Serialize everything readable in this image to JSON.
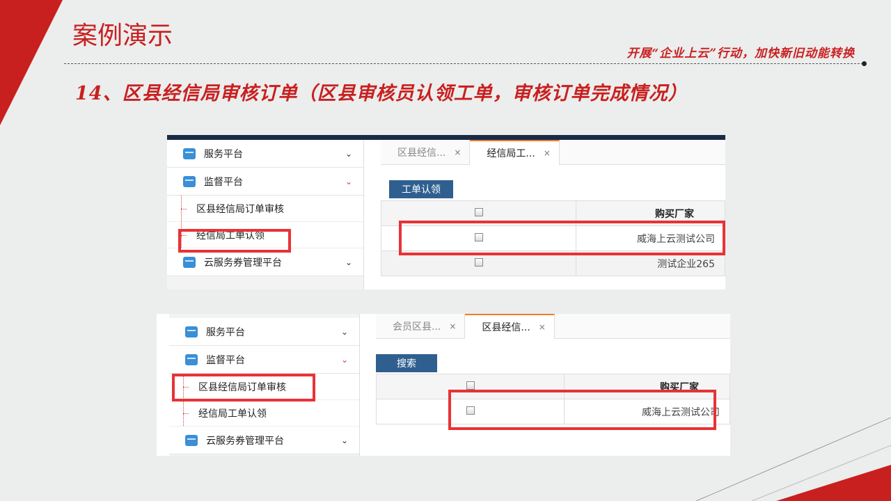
{
  "slide": {
    "title": "案例演示",
    "slogan": "开展“企业上云”行动，加快新旧动能转换",
    "heading": "14、区县经信局审核订单（区县审核员认领工单，审核订单完成情况）",
    "accent_color": "#c8201f"
  },
  "shot1": {
    "sidebar": {
      "items": [
        {
          "label": "服务平台",
          "icon": "folder-icon",
          "chevron": "chevron-down-icon"
        },
        {
          "label": "监督平台",
          "icon": "folder-icon",
          "chevron": "chevron-down-icon"
        }
      ],
      "sub_items": [
        {
          "label": "区县经信局订单审核"
        },
        {
          "label": "经信局工单认领"
        }
      ],
      "last_item": {
        "label": "云服务券管理平台",
        "icon": "folder-icon",
        "chevron": "chevron-down-icon"
      }
    },
    "tabs": [
      {
        "label": "区县经信...",
        "close": "×"
      },
      {
        "label": "经信局工...",
        "close": "×"
      }
    ],
    "action_button": "工单认领",
    "table": {
      "columns": [
        "",
        "购买厂家"
      ],
      "rows": [
        {
          "vendor": "威海上云测试公司"
        },
        {
          "vendor": "测试企业265"
        }
      ]
    }
  },
  "shot2": {
    "sidebar": {
      "items": [
        {
          "label": "服务平台"
        },
        {
          "label": "监督平台"
        }
      ],
      "sub_items": [
        {
          "label": "区县经信局订单审核"
        },
        {
          "label": "经信局工单认领"
        }
      ],
      "last_item": {
        "label": "云服务券管理平台"
      }
    },
    "tabs": [
      {
        "label": "会员区县...",
        "close": "×"
      },
      {
        "label": "区县经信...",
        "close": "×"
      }
    ],
    "action_button": "搜索",
    "table": {
      "columns": [
        "",
        "购买厂家"
      ],
      "rows": [
        {
          "vendor": "威海上云测试公司"
        }
      ]
    }
  }
}
